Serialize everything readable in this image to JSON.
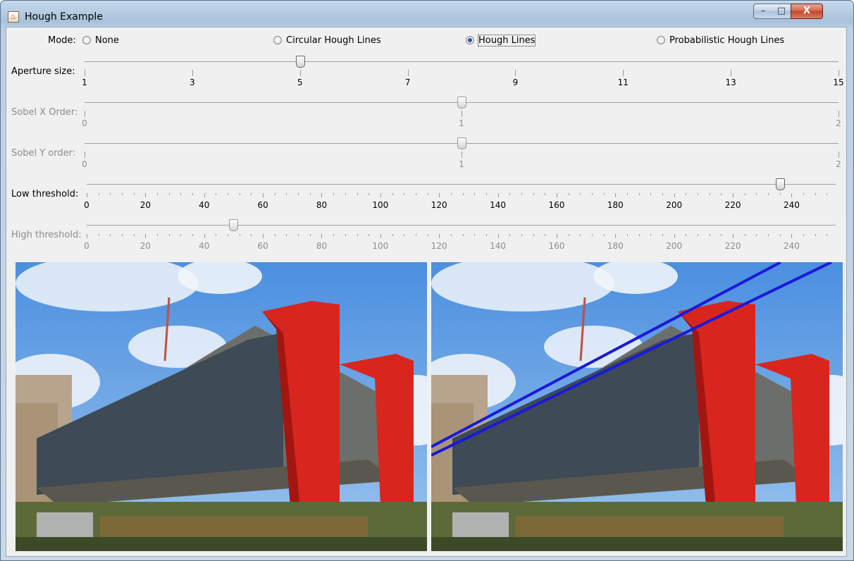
{
  "window": {
    "title": "Hough Example",
    "controls": {
      "minimize": "–",
      "maximize": "□",
      "close": "X"
    }
  },
  "mode": {
    "label": "Mode:",
    "options": [
      {
        "label": "None",
        "selected": false
      },
      {
        "label": "Circular Hough Lines",
        "selected": false
      },
      {
        "label": "Hough Lines",
        "selected": true
      },
      {
        "label": "Probabilistic Hough Lines",
        "selected": false
      }
    ]
  },
  "sliders": {
    "aperture": {
      "label": "Aperture size:",
      "value": 5,
      "min": 1,
      "max": 15,
      "ticks": [
        "1",
        "3",
        "5",
        "7",
        "9",
        "11",
        "13",
        "15"
      ],
      "enabled": true
    },
    "sobel_x": {
      "label": "Sobel X Order:",
      "value": 1,
      "min": 0,
      "max": 2,
      "ticks": [
        "0",
        "1",
        "2"
      ],
      "enabled": false
    },
    "sobel_y": {
      "label": "Sobel Y order:",
      "value": 1,
      "min": 0,
      "max": 2,
      "ticks": [
        "0",
        "1",
        "2"
      ],
      "enabled": false
    },
    "low_threshold": {
      "label": "Low threshold:",
      "value": 236,
      "min": 0,
      "max": 255,
      "ticks": [
        "0",
        "20",
        "40",
        "60",
        "80",
        "100",
        "120",
        "140",
        "160",
        "180",
        "200",
        "220",
        "240"
      ],
      "enabled": true
    },
    "high_threshold": {
      "label": "High threshold:",
      "value": 50,
      "min": 0,
      "max": 255,
      "ticks": [
        "0",
        "20",
        "40",
        "60",
        "80",
        "100",
        "120",
        "140",
        "160",
        "180",
        "200",
        "220",
        "240"
      ],
      "enabled": false
    }
  },
  "images": {
    "left": {
      "name": "original-photo"
    },
    "right": {
      "name": "hough-lines-result"
    }
  },
  "colors": {
    "building_red": "#d8261e",
    "hough_line": "#1a1ad8",
    "sky": "#5f9be0"
  }
}
